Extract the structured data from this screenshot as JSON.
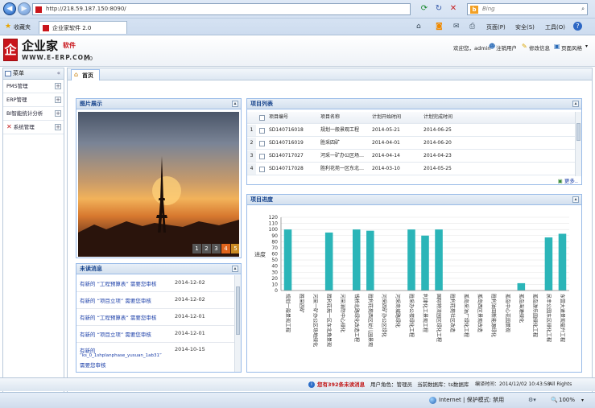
{
  "browser": {
    "url": "http://218.59.187.150:8090/",
    "search_placeholder": "Bing",
    "favorites_label": "收藏夹",
    "tab_title": "企业家软件 2.0",
    "menu": [
      "页面(P)",
      "安全(S)",
      "工具(O)"
    ]
  },
  "app": {
    "logo_char": "企",
    "brand_name": "企业家",
    "brand_sub": "软件",
    "brand_domain": "WWW.E-ERP.COM",
    "brand_version": "2.0",
    "welcome": "欢迎您，admin",
    "logout": "注销用户",
    "change_info": "修改信息",
    "page_style": "页面风格"
  },
  "sidebar": {
    "title": "菜单",
    "items": [
      {
        "label": "PMS管理"
      },
      {
        "label": "ERP管理"
      },
      {
        "label": "BI智能统计分析"
      },
      {
        "label": "系统管理"
      }
    ]
  },
  "main_tab": "首页",
  "photo_panel": {
    "title": "图片展示",
    "pages": [
      "1",
      "2",
      "3",
      "4",
      "5"
    ],
    "active_page": "4"
  },
  "messages_panel": {
    "title": "未读消息",
    "rows": [
      {
        "title": "有新的 “工程预算表” 需要您审核",
        "date": "2014-12-02"
      },
      {
        "title": "有新的 “项目立项” 需要您审核",
        "date": "2014-12-02"
      },
      {
        "title": "有新的 “工程预算表” 需要您审核",
        "date": "2014-12-01"
      },
      {
        "title": "有新的 “项目立项” 需要您审核",
        "date": "2014-12-01"
      },
      {
        "title": "有新的",
        "line2": "“ks_0_1shplanphase_yusuan_1ab31”",
        "line3": "需要您审核",
        "date": "2014-10-15"
      }
    ]
  },
  "projects_panel": {
    "title": "项目列表",
    "columns": [
      "项目编号",
      "项目名称",
      "计划开始时间",
      "计划完成时间"
    ],
    "rows": [
      {
        "n": "1",
        "code": "SD140716018",
        "name": "规划一般景观工程",
        "start": "2014-05-21",
        "end": "2014-06-25"
      },
      {
        "n": "2",
        "code": "SD140716019",
        "name": "胜采四矿",
        "start": "2014-04-01",
        "end": "2014-06-20"
      },
      {
        "n": "3",
        "code": "SD140717027",
        "name": "河采一矿办公区场…",
        "start": "2014-04-14",
        "end": "2014-04-23"
      },
      {
        "n": "4",
        "code": "SD140717028",
        "name": "胜利花苑一区东北…",
        "start": "2014-03-10",
        "end": "2014-05-25"
      }
    ],
    "more": "更多.."
  },
  "progress_panel": {
    "title": "项目进度"
  },
  "chart_data": {
    "type": "bar",
    "ylabel": "进度",
    "ylim": [
      0,
      120
    ],
    "yticks": [
      0,
      10,
      20,
      30,
      40,
      50,
      60,
      70,
      80,
      90,
      100,
      110,
      120
    ],
    "color": "#2bb5b8",
    "categories": [
      "规划一般景观工程",
      "胜采四矿",
      "河采一矿办公区场地绿化",
      "胜利花苑一区东北角景观",
      "河采消防中心绿化",
      "钱桥北路绿化改造工程",
      "胜利花苑西区幼儿园景观",
      "河采四矿办公区绿化",
      "河采商城路绿化",
      "胜采办公楼绿化工程",
      "利津化工景观工程",
      "国际物流园区绿化工程",
      "胜利花苑社区改造",
      "孤岛采油厂绿化工程",
      "孤岛西区景观改造",
      "胜利油田新能源绿化",
      "孤岛中心花园景观",
      "孤岛海港绿化",
      "孤岛游乐园绿化工程",
      "民丰公园东区绿化工程",
      "东营大道景观提升工程"
    ],
    "values": [
      100,
      0,
      0,
      95,
      0,
      100,
      98,
      0,
      0,
      100,
      90,
      100,
      0,
      0,
      0,
      0,
      0,
      12,
      0,
      87,
      93
    ]
  },
  "status": {
    "unread_prefix": "您有",
    "unread_count": "392",
    "unread_suffix": "条未读消息",
    "role": "用户角色：管理员",
    "db": "当前数据库：ts数据库",
    "compile_time": "编译时间：2014/12/02 10:43:58",
    "rights": "All Rights Reserved"
  },
  "ie_status": {
    "zone": "Internet | 保护模式: 禁用",
    "zoom": "100%"
  }
}
